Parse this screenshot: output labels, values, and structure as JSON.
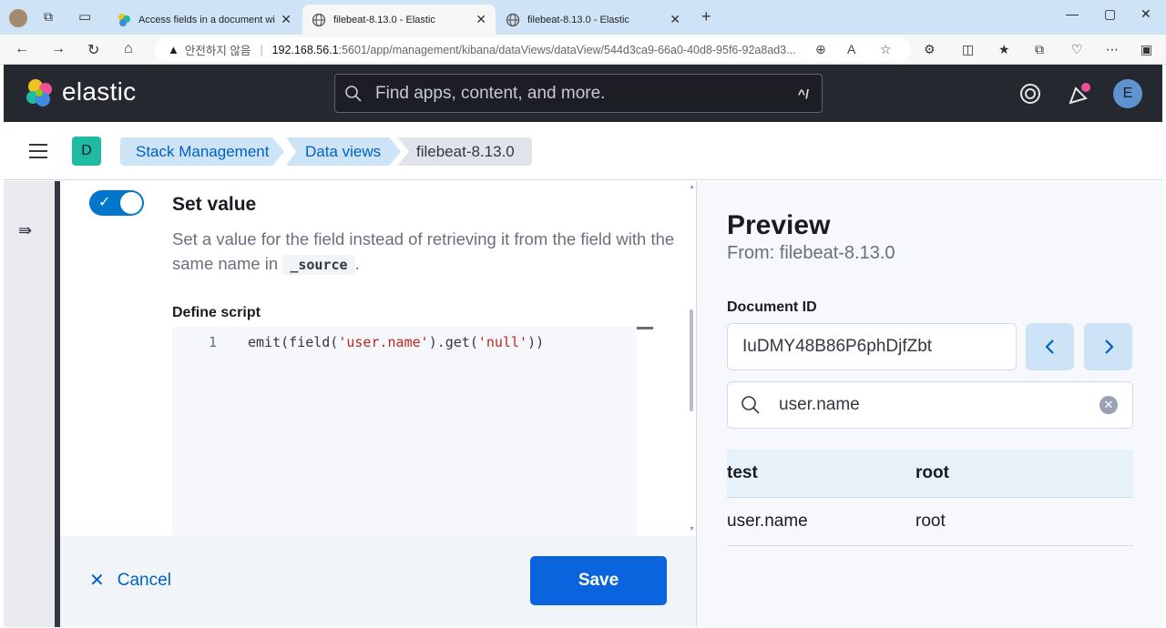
{
  "browser": {
    "tabs": [
      {
        "title": "Access fields in a document with"
      },
      {
        "title": "filebeat-8.13.0 - Elastic"
      },
      {
        "title": "filebeat-8.13.0 - Elastic"
      }
    ],
    "address": {
      "insecure_label": "안전하지 않음",
      "host": "192.168.56.1",
      "path": ":5601/app/management/kibana/dataViews/dataView/544d3ca9-66a0-40d8-95f6-92a8ad3..."
    }
  },
  "header": {
    "logo_text": "elastic",
    "search_placeholder": "Find apps, content, and more.",
    "search_shortcut": "^/",
    "avatar_initial": "E"
  },
  "breadcrumbs": {
    "space_initial": "D",
    "items": [
      "Stack Management",
      "Data views",
      "filebeat-8.13.0"
    ]
  },
  "editor": {
    "set_value_title": "Set value",
    "set_value_desc_pre": "Set a value for the field instead of retrieving it from the field with the same name in",
    "set_value_desc_code": "_source",
    "set_value_desc_post": ".",
    "define_script_label": "Define script",
    "line_number": "1",
    "code_pre": "emit(field(",
    "code_str1": "'user.name'",
    "code_mid": ").get(",
    "code_str2": "'null'",
    "code_post": "))",
    "cancel_label": "Cancel",
    "save_label": "Save"
  },
  "preview": {
    "title": "Preview",
    "from": "From: filebeat-8.13.0",
    "document_id_label": "Document ID",
    "document_id_value": "IuDMY48B86P6phDjfZbt",
    "field_search_value": "user.name",
    "table": {
      "header": [
        "test",
        "root"
      ],
      "rows": [
        [
          "user.name",
          "root"
        ]
      ]
    }
  },
  "colors": {
    "primary": "#0b64dd",
    "header_bg": "#25282f",
    "space_badge": "#1fbaa2"
  }
}
